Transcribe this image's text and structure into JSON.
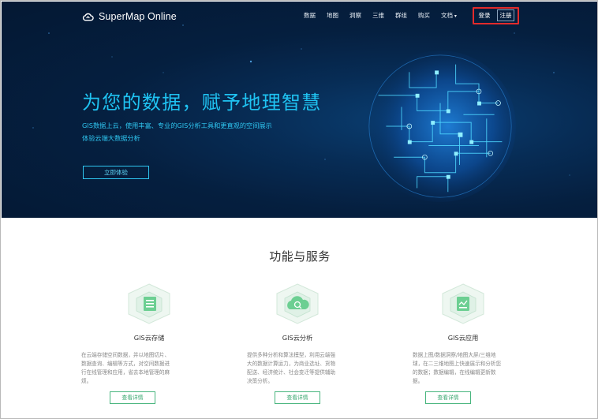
{
  "header": {
    "brand": "SuperMap Online",
    "nav": [
      "数据",
      "地图",
      "洞察",
      "三维",
      "群组",
      "购买",
      "文档"
    ],
    "login_label": "登录",
    "register_label": "注册"
  },
  "hero": {
    "headline": "为您的数据，赋予地理智慧",
    "subline_1": "GIS数据上云，使用丰富、专业的GIS分析工具和更直观的空间展示",
    "subline_2": "体验云端大数据分析",
    "cta_label": "立即体验"
  },
  "services": {
    "title": "功能与服务",
    "cards": [
      {
        "title": "GIS云存储",
        "desc": [
          "在云端存储空间数据，并以地图切片、",
          "数据查询、编辑等方式，对空间数据进",
          "行在线管理和应用，省去本地管理的麻",
          "烦。"
        ],
        "button": "查看详情"
      },
      {
        "title": "GIS云分析",
        "desc": [
          "提供多种分析和算法模型，利用云端强",
          "大的数据计算运力，为商业选址、货物",
          "配送、经济统计、社会变迁等提供辅助",
          "决策分析。"
        ],
        "button": "查看详情"
      },
      {
        "title": "GIS云应用",
        "desc": [
          "数据上图/数据洞察/地图大屏/三维地",
          "球，在二三维地图上快速展示和分析您",
          "的数据；数据编辑，在线编辑更新数",
          "据。"
        ],
        "button": "查看详情"
      }
    ]
  },
  "colors": {
    "hero_bg": "#041833",
    "accent_cyan": "#1fc3f2",
    "highlight_red": "#e32b2b",
    "button_green": "#3aa870"
  }
}
